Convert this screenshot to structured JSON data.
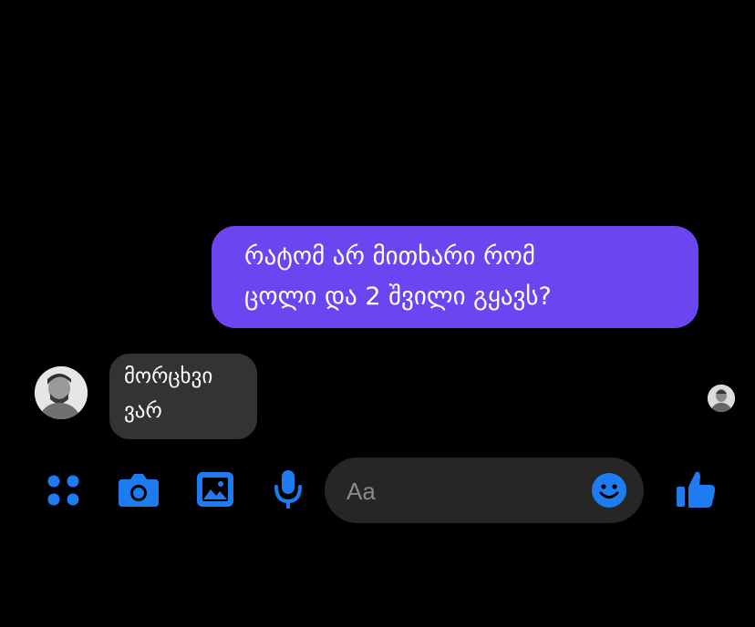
{
  "conversation": {
    "sent_message": {
      "text": "რატომ არ მითხარი რომ\nცოლი და 2 შვილი გყავს?"
    },
    "received_message": {
      "text": "მორცხვი\nვარ"
    }
  },
  "composer": {
    "placeholder": "Aa"
  },
  "icons": {
    "menu": "four-dots-icon",
    "camera": "camera-icon",
    "gallery": "image-icon",
    "voice": "microphone-icon",
    "emoji": "smiley-icon",
    "like": "thumbs-up-icon"
  },
  "colors": {
    "background": "#000000",
    "sent_bubble": "#6b46f0",
    "received_bubble": "#333333",
    "accent": "#1f7cf0",
    "composer": "#262626"
  }
}
